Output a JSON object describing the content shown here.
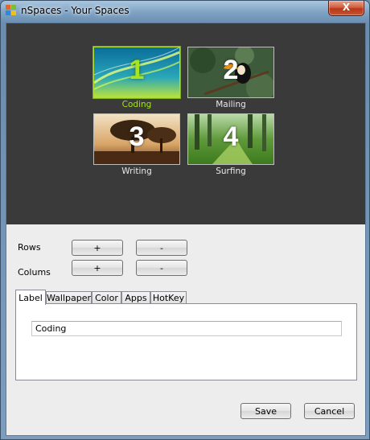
{
  "window": {
    "title": "nSpaces - Your Spaces",
    "close_label": "X"
  },
  "spaces": [
    {
      "number": "1",
      "caption": "Coding"
    },
    {
      "number": "2",
      "caption": "Mailing"
    },
    {
      "number": "3",
      "caption": "Writing"
    },
    {
      "number": "4",
      "caption": "Surfing"
    }
  ],
  "grid": {
    "rows_label": "Rows",
    "columns_label": "Colums",
    "add_label": "+",
    "remove_label": "-"
  },
  "tabs": [
    "Label",
    "Wallpaper",
    "Color",
    "Apps",
    "HotKey"
  ],
  "label_tab": {
    "value": "Coding"
  },
  "footer": {
    "save_label": "Save",
    "cancel_label": "Cancel"
  },
  "colors": {
    "selected_accent": "#a6e41f",
    "preview_background": "#3a3a3a"
  }
}
